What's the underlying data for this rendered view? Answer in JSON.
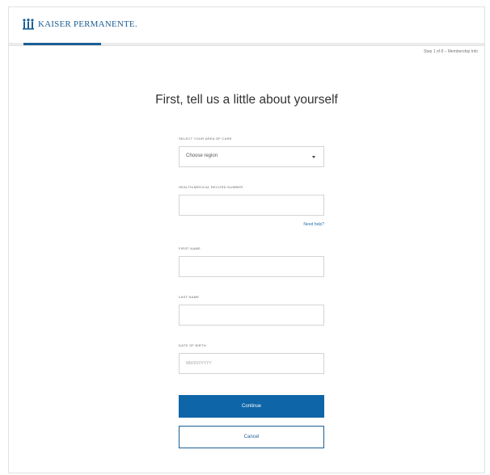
{
  "brand": {
    "name": "KAISER PERMANENTE.",
    "color": "#1b5f96"
  },
  "progress": {
    "step_text": "Step 1 of 8 – Membership Info",
    "fraction": 0.125
  },
  "title": "First, tell us a little about yourself",
  "form": {
    "region": {
      "label": "SELECT YOUR AREA OF CARE",
      "value": "Choose region"
    },
    "record_number": {
      "label": "HEALTH/MEDICAL RECORD NUMBER",
      "value": "",
      "help_link": "Need help?"
    },
    "first_name": {
      "label": "FIRST NAME",
      "value": ""
    },
    "last_name": {
      "label": "LAST NAME",
      "value": ""
    },
    "dob": {
      "label": "DATE OF BIRTH",
      "placeholder": "MM/DD/YYYY"
    },
    "continue_label": "Continue",
    "cancel_label": "Cancel"
  },
  "colors": {
    "primary": "#0e65a7",
    "link": "#2a6fb0"
  },
  "icons": {
    "logo": "kp-logo-icon",
    "dropdown": "chevron-down-icon"
  }
}
